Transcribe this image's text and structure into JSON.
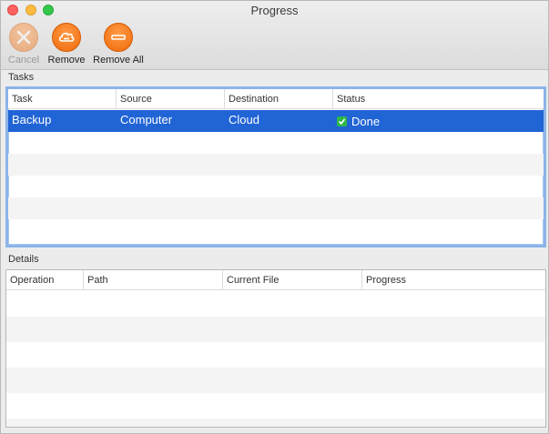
{
  "window": {
    "title": "Progress"
  },
  "toolbar": {
    "cancel_label": "Cancel",
    "remove_label": "Remove",
    "remove_all_label": "Remove All",
    "accent_color": "#f27a1a"
  },
  "tasks": {
    "section_label": "Tasks",
    "columns": [
      "Task",
      "Source",
      "Destination",
      "Status"
    ],
    "rows": [
      {
        "task": "Backup",
        "source": "Computer",
        "destination": "Cloud",
        "status": "Done",
        "status_icon": "check-icon"
      }
    ],
    "selection_color": "#2164d5"
  },
  "details": {
    "section_label": "Details",
    "columns": [
      "Operation",
      "Path",
      "Current File",
      "Progress"
    ]
  }
}
